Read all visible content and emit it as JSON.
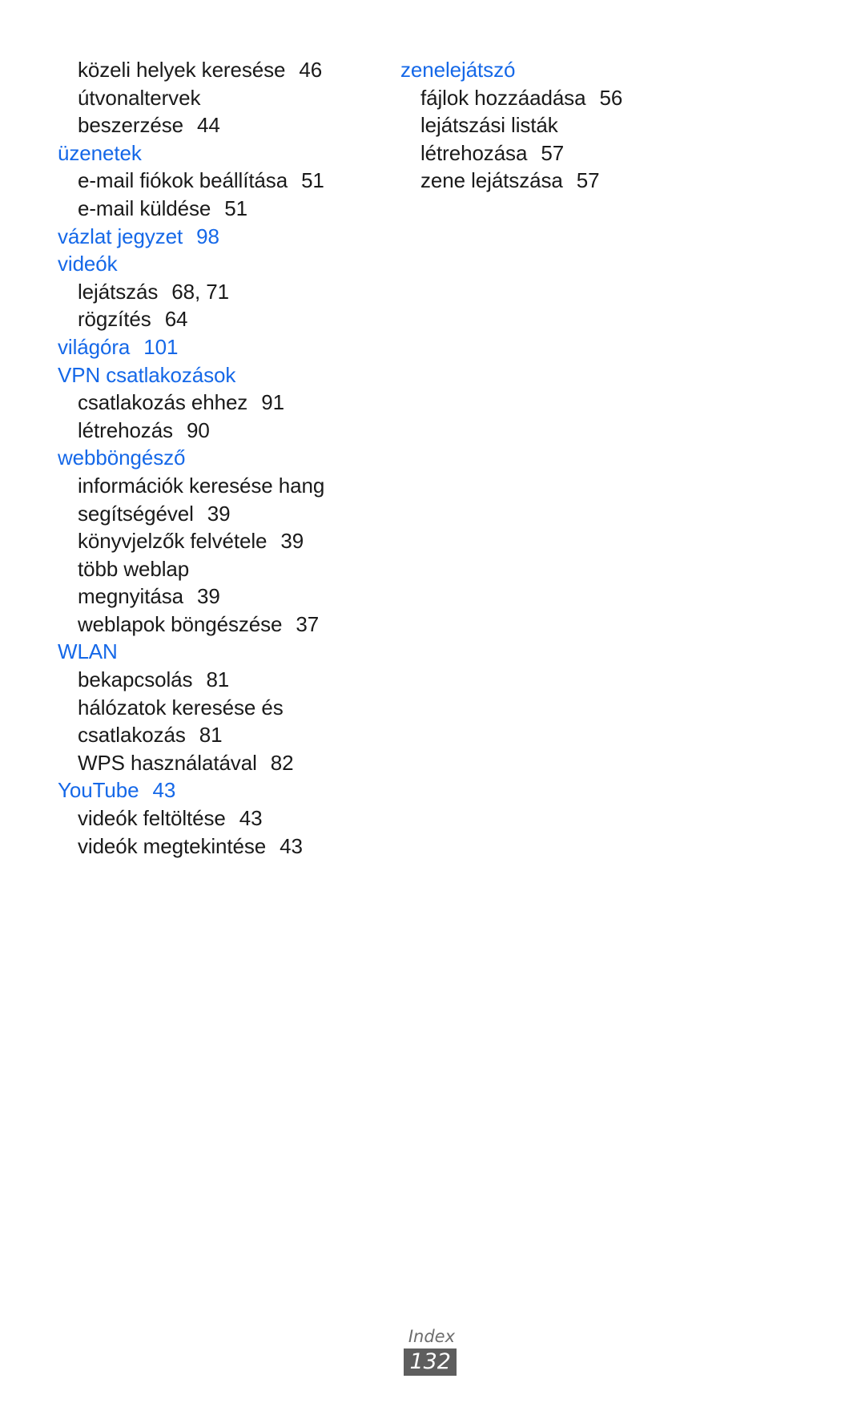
{
  "document": {
    "kind": "index-page",
    "language": "hu",
    "accent_color": "#1568e8",
    "text_color": "#1a1a1a",
    "footer_badge_color": "#5e5e5e"
  },
  "columns": [
    {
      "name": "left-column",
      "entries": [
        {
          "type": "sub",
          "label": "közeli helyek keresése",
          "page": "46"
        },
        {
          "type": "sub",
          "label": "útvonaltervek",
          "page": ""
        },
        {
          "type": "cont",
          "label": "beszerzése",
          "page": "44"
        },
        {
          "type": "heading",
          "label": "üzenetek",
          "page": ""
        },
        {
          "type": "sub",
          "label": "e-mail fiókok beállítása",
          "page": "51"
        },
        {
          "type": "sub",
          "label": "e-mail küldése",
          "page": "51"
        },
        {
          "type": "heading",
          "label": "vázlat jegyzet",
          "page": "98"
        },
        {
          "type": "heading",
          "label": "videók",
          "page": ""
        },
        {
          "type": "sub",
          "label": "lejátszás",
          "page": "68, 71"
        },
        {
          "type": "sub",
          "label": "rögzítés",
          "page": "64"
        },
        {
          "type": "heading",
          "label": "világóra",
          "page": "101"
        },
        {
          "type": "heading",
          "label": "VPN csatlakozások",
          "page": ""
        },
        {
          "type": "sub",
          "label": "csatlakozás ehhez",
          "page": "91"
        },
        {
          "type": "sub",
          "label": "létrehozás",
          "page": "90"
        },
        {
          "type": "heading",
          "label": "webböngésző",
          "page": ""
        },
        {
          "type": "sub",
          "label": "információk keresése hang",
          "page": ""
        },
        {
          "type": "cont",
          "label": "segítségével",
          "page": "39"
        },
        {
          "type": "sub",
          "label": "könyvjelzők felvétele",
          "page": "39"
        },
        {
          "type": "sub",
          "label": "több weblap",
          "page": ""
        },
        {
          "type": "cont",
          "label": "megnyitása",
          "page": "39"
        },
        {
          "type": "sub",
          "label": "weblapok böngészése",
          "page": "37"
        },
        {
          "type": "heading",
          "label": "WLAN",
          "page": ""
        },
        {
          "type": "sub",
          "label": "bekapcsolás",
          "page": "81"
        },
        {
          "type": "sub",
          "label": "hálózatok keresése és",
          "page": ""
        },
        {
          "type": "cont",
          "label": "csatlakozás",
          "page": "81"
        },
        {
          "type": "sub",
          "label": "WPS használatával",
          "page": "82"
        },
        {
          "type": "heading",
          "label": "YouTube",
          "page": "43"
        },
        {
          "type": "sub",
          "label": "videók feltöltése",
          "page": "43"
        },
        {
          "type": "sub",
          "label": "videók megtekintése",
          "page": "43"
        }
      ]
    },
    {
      "name": "right-column",
      "entries": [
        {
          "type": "heading",
          "label": "zenelejátszó",
          "page": ""
        },
        {
          "type": "sub",
          "label": "fájlok hozzáadása",
          "page": "56"
        },
        {
          "type": "sub",
          "label": "lejátszási listák",
          "page": ""
        },
        {
          "type": "cont",
          "label": "létrehozása",
          "page": "57"
        },
        {
          "type": "sub",
          "label": "zene lejátszása",
          "page": "57"
        }
      ]
    }
  ],
  "footer": {
    "section_label": "Index",
    "page_number": "132"
  }
}
